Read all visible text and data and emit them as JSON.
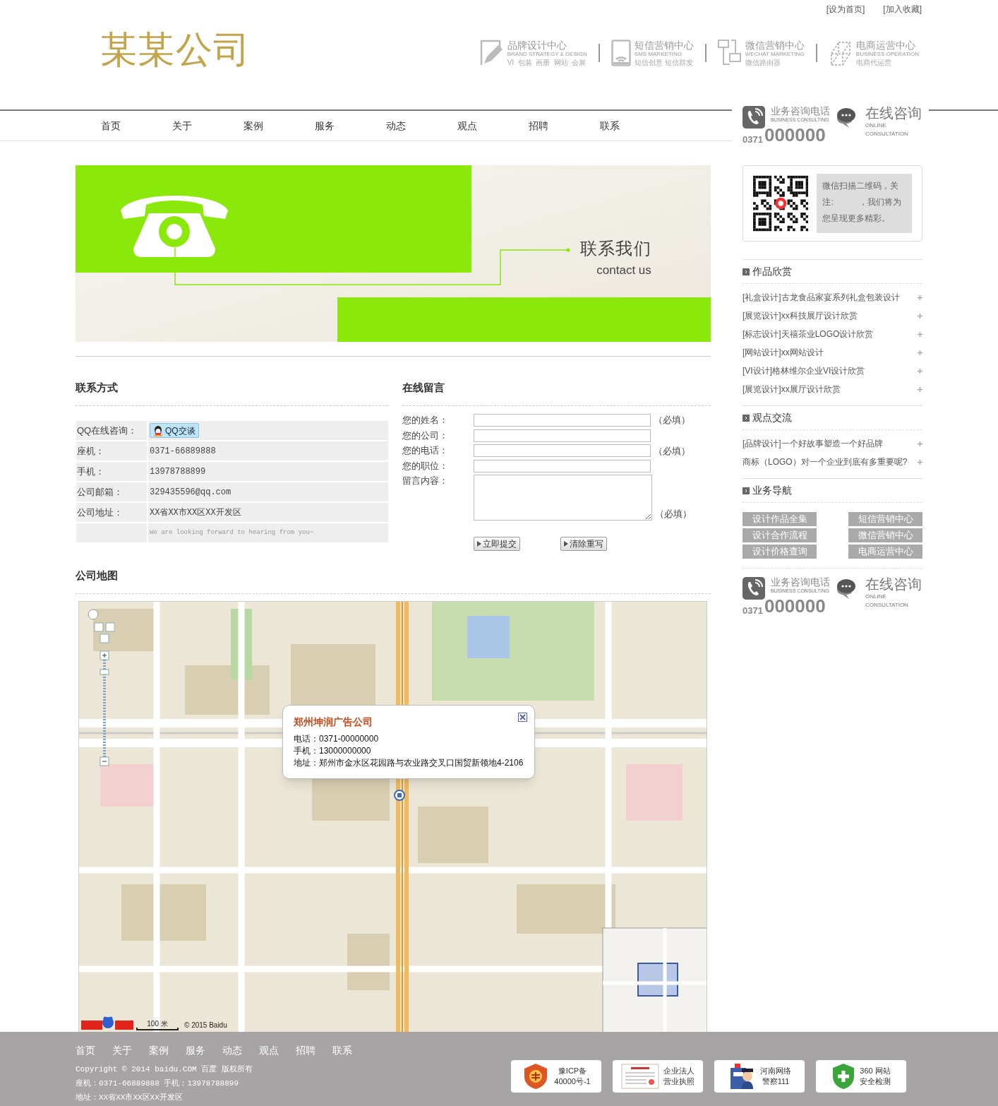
{
  "top_links": [
    "[设为首页]",
    "[加入收藏]"
  ],
  "logo": "某某公司",
  "services": [
    {
      "kind": "brand",
      "title": "品牌设计中心",
      "subtitle": "BRAND STRATEGY & DESIGN",
      "desc": "VI  包装  画册  网站  会展"
    },
    {
      "kind": "sms",
      "title": "短信营销中心",
      "subtitle": "SMS MARKETING",
      "desc": "短信创意 短信群发"
    },
    {
      "kind": "wechat",
      "title": "微信营销中心",
      "subtitle": "WECHAT MARKETING",
      "desc": "微信路由器"
    },
    {
      "kind": "ecommerce",
      "title": "电商运营中心",
      "subtitle": "BUSINESS OPERATION",
      "desc": "电商代运营"
    }
  ],
  "nav": [
    "首页",
    "关于",
    "案例",
    "服务",
    "动态",
    "观点",
    "招聘",
    "联系"
  ],
  "banner": {
    "title": "联系我们",
    "subtitle": "contact us"
  },
  "contact": {
    "heading": "联系方式",
    "rows": [
      {
        "kind": "qq",
        "label": "QQ在线咨询：",
        "value": "QQ交谈"
      },
      {
        "kind": "text",
        "label": "座机：",
        "value": "0371-66889888"
      },
      {
        "kind": "text",
        "label": "手机：",
        "value": "13978788899"
      },
      {
        "kind": "text",
        "label": "公司邮箱：",
        "value": "329435596@qq.com"
      },
      {
        "kind": "text",
        "label": "公司地址：",
        "value": "XX省XX市XX区XX开发区"
      },
      {
        "kind": "note",
        "value": "We are looking forward to hearing from you~"
      }
    ]
  },
  "form": {
    "heading": "在线留言",
    "fields": [
      {
        "kind": "input",
        "label": "您的姓名：",
        "note": "（必填）"
      },
      {
        "kind": "input",
        "label": "您的公司："
      },
      {
        "kind": "input",
        "label": "您的电话：",
        "note": "（必填）"
      },
      {
        "kind": "input",
        "label": "您的职位："
      },
      {
        "kind": "textarea",
        "label": "留言内容：",
        "note": "（必填）"
      }
    ],
    "buttons": [
      "立即提交",
      "清除重写"
    ]
  },
  "map": {
    "heading": "公司地图",
    "popup": {
      "title": "郑州坤润广告公司",
      "lines": [
        "电话：0371-00000000",
        "手机：13000000000",
        "地址：郑州市金水区花园路与农业路交叉口国贸新领地4-2106"
      ]
    },
    "scale": "100 米",
    "copyright": "© 2015 Baidu"
  },
  "consults": [
    {
      "phone_label": "业务咨询电话",
      "phone_sub": "BUSINESS CONSULTING",
      "area_code": "0371",
      "number": "000000",
      "online": "在线咨询",
      "online_sub": [
        "ONLINE",
        "CONSULTATION"
      ]
    },
    {
      "phone_label": "业务咨询电话",
      "phone_sub": "BUSINESS CONSULTING",
      "area_code": "0371",
      "number": "000000",
      "online": "在线咨询",
      "online_sub": [
        "ONLINE",
        "CONSULTATION"
      ]
    }
  ],
  "qr": {
    "text": "微信扫描二维码，关注:　　　，我们将为您呈现更多精彩。"
  },
  "works": {
    "heading": "作品欣赏",
    "items": [
      "[礼盒设计]古龙食品家宴系列礼盒包装设计",
      "[展览设计]xx科技展厅设计欣赏",
      "[标志设计]天禧茶业LOGO设计欣赏",
      "[网站设计]xx网站设计",
      "[VI设计]格林维尔企业VI设计欣赏",
      "[展览设计]xx展厅设计欣赏"
    ]
  },
  "views": {
    "heading": "观点交流",
    "items": [
      "[品牌设计]一个好故事塑造一个好品牌",
      "商标（LOGO）对一个企业到底有多重要呢?"
    ]
  },
  "business": {
    "heading": "业务导航",
    "items": [
      "设计作品全集",
      "短信营销中心",
      "设计合作流程",
      "微信营销中心",
      "设计价格查询",
      "电商运营中心"
    ]
  },
  "footer": {
    "nav": [
      "首页",
      "关于",
      "案例",
      "服务",
      "动态",
      "观点",
      "招聘",
      "联系"
    ],
    "lines": [
      "Copyright © 2014 baidu.COM 百度 版权所有",
      "座机：0371-66889888 手机：13978788899",
      "地址：XX省XX市XX区XX开发区"
    ],
    "badges": [
      {
        "kind": "icp",
        "lines": [
          "豫ICP备",
          "40000号-1"
        ]
      },
      {
        "kind": "license",
        "lines": [
          "企业法人",
          "营业执照"
        ]
      },
      {
        "kind": "police",
        "lines": [
          "河南网络",
          "警察111"
        ]
      },
      {
        "kind": "safety",
        "lines": [
          "360 网站",
          "安全检测"
        ]
      }
    ]
  }
}
